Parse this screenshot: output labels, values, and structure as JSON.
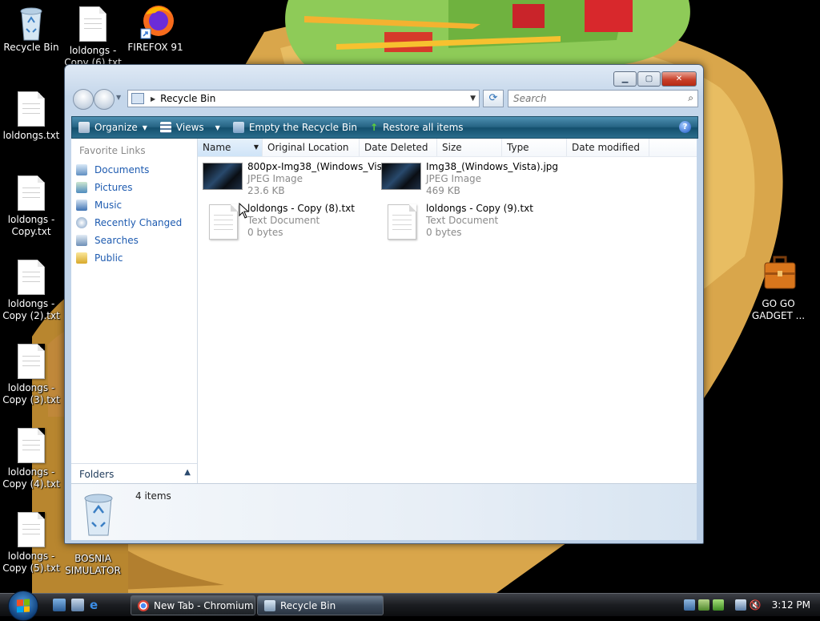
{
  "desktop": {
    "icons": [
      {
        "label": "Recycle Bin"
      },
      {
        "label": "loldongs - Copy (6).txt"
      },
      {
        "label": "FIREFOX 91"
      },
      {
        "label": "loldongs.txt"
      },
      {
        "label": "loldongs - Copy.txt"
      },
      {
        "label": "loldongs - Copy (2).txt"
      },
      {
        "label": "loldongs - Copy (3).txt"
      },
      {
        "label": "loldongs - Copy (4).txt"
      },
      {
        "label": "loldongs - Copy (5).txt"
      },
      {
        "label": "BOSNIA SIMULATOR"
      },
      {
        "label": "GO GO GADGET ..."
      }
    ]
  },
  "window": {
    "address": {
      "crumb": "Recycle Bin"
    },
    "search": {
      "placeholder": "Search"
    },
    "toolbar": {
      "organize": "Organize",
      "views": "Views",
      "empty": "Empty the Recycle Bin",
      "restore": "Restore all items",
      "help": "?"
    },
    "nav": {
      "title": "Favorite Links",
      "links": [
        "Documents",
        "Pictures",
        "Music",
        "Recently Changed",
        "Searches",
        "Public"
      ],
      "folders": "Folders"
    },
    "columns": [
      "Name",
      "Original Location",
      "Date Deleted",
      "Size",
      "Type",
      "Date modified"
    ],
    "files": [
      {
        "name": "800px-Img38_(Windows_Vis...",
        "type": "JPEG Image",
        "size": "23.6 KB"
      },
      {
        "name": "Img38_(Windows_Vista).jpg",
        "type": "JPEG Image",
        "size": "469 KB"
      },
      {
        "name": "loldongs - Copy (8).txt",
        "type": "Text Document",
        "size": "0 bytes"
      },
      {
        "name": "loldongs - Copy (9).txt",
        "type": "Text Document",
        "size": "0 bytes"
      }
    ],
    "details": {
      "count": "4 items"
    }
  },
  "taskbar": {
    "buttons": [
      {
        "label": "New Tab - Chromium"
      },
      {
        "label": "Recycle Bin"
      }
    ],
    "clock": "3:12 PM"
  },
  "colors": {
    "accent": "#256383",
    "link": "#1e5bb0",
    "desktop": "#000000"
  }
}
